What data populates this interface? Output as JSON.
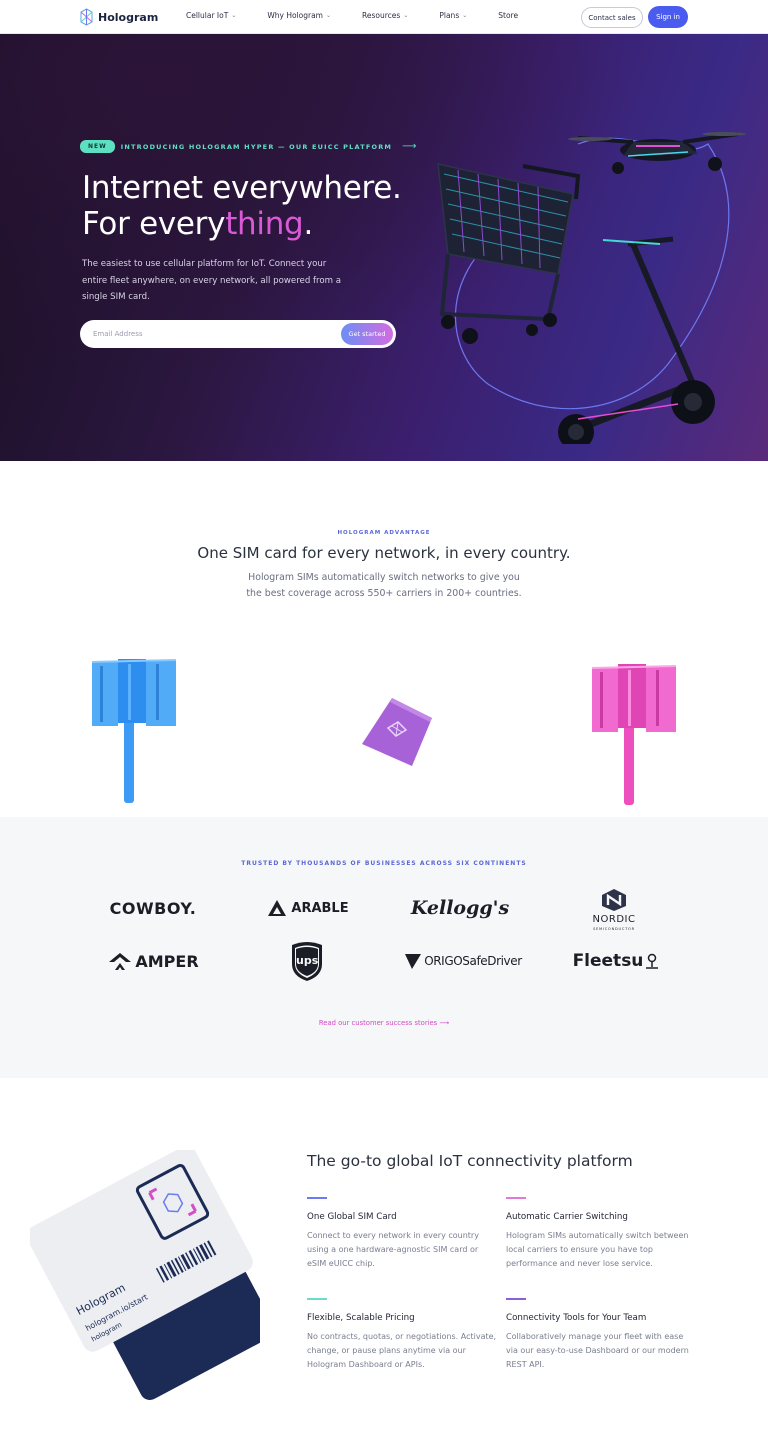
{
  "nav": {
    "brand": "Hologram",
    "items": [
      {
        "label": "Cellular IoT",
        "has_dropdown": true
      },
      {
        "label": "Why Hologram",
        "has_dropdown": true
      },
      {
        "label": "Resources",
        "has_dropdown": true
      },
      {
        "label": "Plans",
        "has_dropdown": true
      },
      {
        "label": "Store",
        "has_dropdown": false
      }
    ],
    "contact_label": "Contact sales",
    "signin_label": "Sign in",
    "chevron": "⌄"
  },
  "hero": {
    "badge": "NEW",
    "announcement": "INTRODUCING HOLOGRAM HYPER — OUR EUICC PLATFORM",
    "arrow": "⟶",
    "headline_line1": "Internet everywhere.",
    "headline_line2_a": "For every",
    "headline_line2_b": "thing",
    "headline_line2_c": ".",
    "lead": "The easiest to use cellular platform for IoT. Connect your entire fleet anywhere, on every network, all powered from a single SIM card.",
    "email_placeholder": "Email Address",
    "cta_label": "Get started"
  },
  "advantage": {
    "label": "HOLOGRAM ADVANTAGE",
    "title": "One SIM card for every network, in every country.",
    "sub_line1": "Hologram SIMs automatically switch networks to give you",
    "sub_line2": "the best coverage across 550+ carriers in 200+ countries."
  },
  "trusted": {
    "label": "TRUSTED BY THOUSANDS OF BUSINESSES ACROSS SIX CONTINENTS",
    "logos": [
      "COWBOY.",
      "ARABLE",
      "Kellogg's",
      "NORDIC",
      "AMPER",
      "ups",
      "ORIGOSafeDriver",
      "Fleetsu"
    ],
    "nordic_sub": "SEMICONDUCTOR",
    "link": "Read our customer success stories ⟶"
  },
  "platform": {
    "title": "The go-to global IoT connectivity platform",
    "sim_card_text": [
      "Hologram",
      "hologram.io/start",
      "hologram"
    ],
    "features": [
      {
        "title": "One Global SIM Card",
        "desc": "Connect to every network in every country using a one hardware-agnostic SIM card or eSIM eUICC chip.",
        "color": "#6b7cf2"
      },
      {
        "title": "Automatic Carrier Switching",
        "desc": "Hologram SIMs automatically switch between local carriers to ensure you have top performance and never lose service.",
        "color": "#e07ad8"
      },
      {
        "title": "Flexible, Scalable Pricing",
        "desc": "No contracts, quotas, or negotiations. Activate, change, or pause plans anytime via our Hologram Dashboard or APIs.",
        "color": "#6fd8d0"
      },
      {
        "title": "Connectivity Tools for Your Team",
        "desc": "Collaboratively manage your fleet with ease via our easy-to-use Dashboard or our modern REST API.",
        "color": "#8a5fd8"
      }
    ]
  },
  "colors": {
    "accent_blue": "#4a5cf0",
    "accent_teal": "#5de0c2",
    "accent_pink": "#d95ad4",
    "tower_blue": "#3d9bf5",
    "tower_pink": "#ee4fbf",
    "sim_purple": "#a862d8"
  }
}
